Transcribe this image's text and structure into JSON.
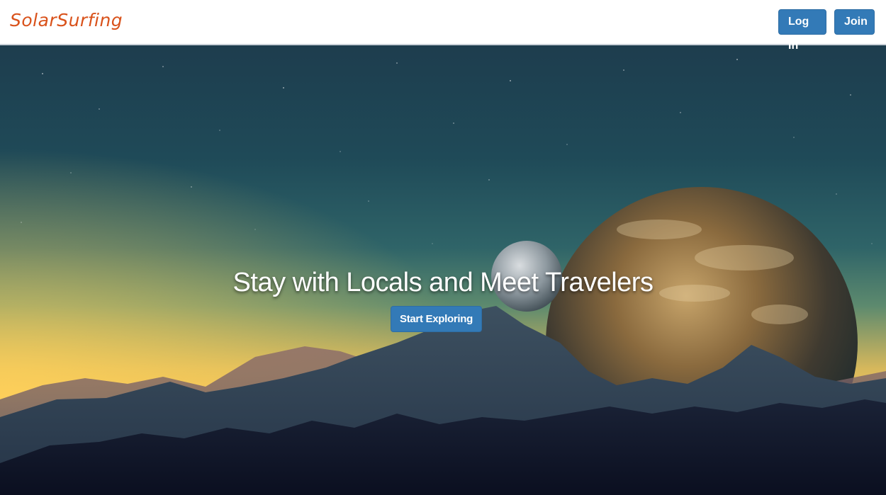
{
  "navbar": {
    "brand": "SolarSurfing",
    "login_label": "Log In",
    "join_label": "Join"
  },
  "hero": {
    "title": "Stay with Locals and Meet Travelers",
    "cta_label": "Start Exploring"
  },
  "colors": {
    "brand": "#d9521b",
    "button": "#337ab7",
    "navbar_bg": "#ffffff"
  }
}
